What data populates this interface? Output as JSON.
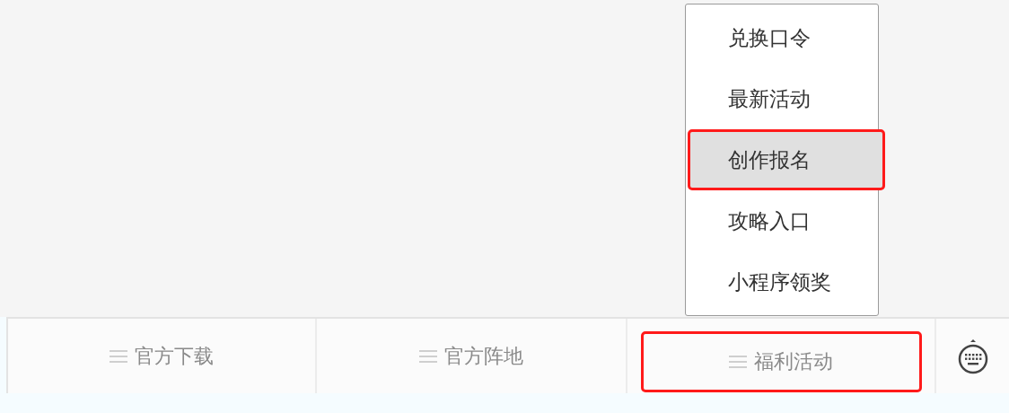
{
  "menu": {
    "items": [
      {
        "label": "兑换口令",
        "selected": false
      },
      {
        "label": "最新活动",
        "selected": false
      },
      {
        "label": "创作报名",
        "selected": true
      },
      {
        "label": "攻略入口",
        "selected": false
      },
      {
        "label": "小程序领奖",
        "selected": false
      }
    ]
  },
  "bottom_bar": {
    "tabs": [
      {
        "label": "官方下载",
        "highlighted": false
      },
      {
        "label": "官方阵地",
        "highlighted": false
      },
      {
        "label": "福利活动",
        "highlighted": true
      }
    ]
  }
}
